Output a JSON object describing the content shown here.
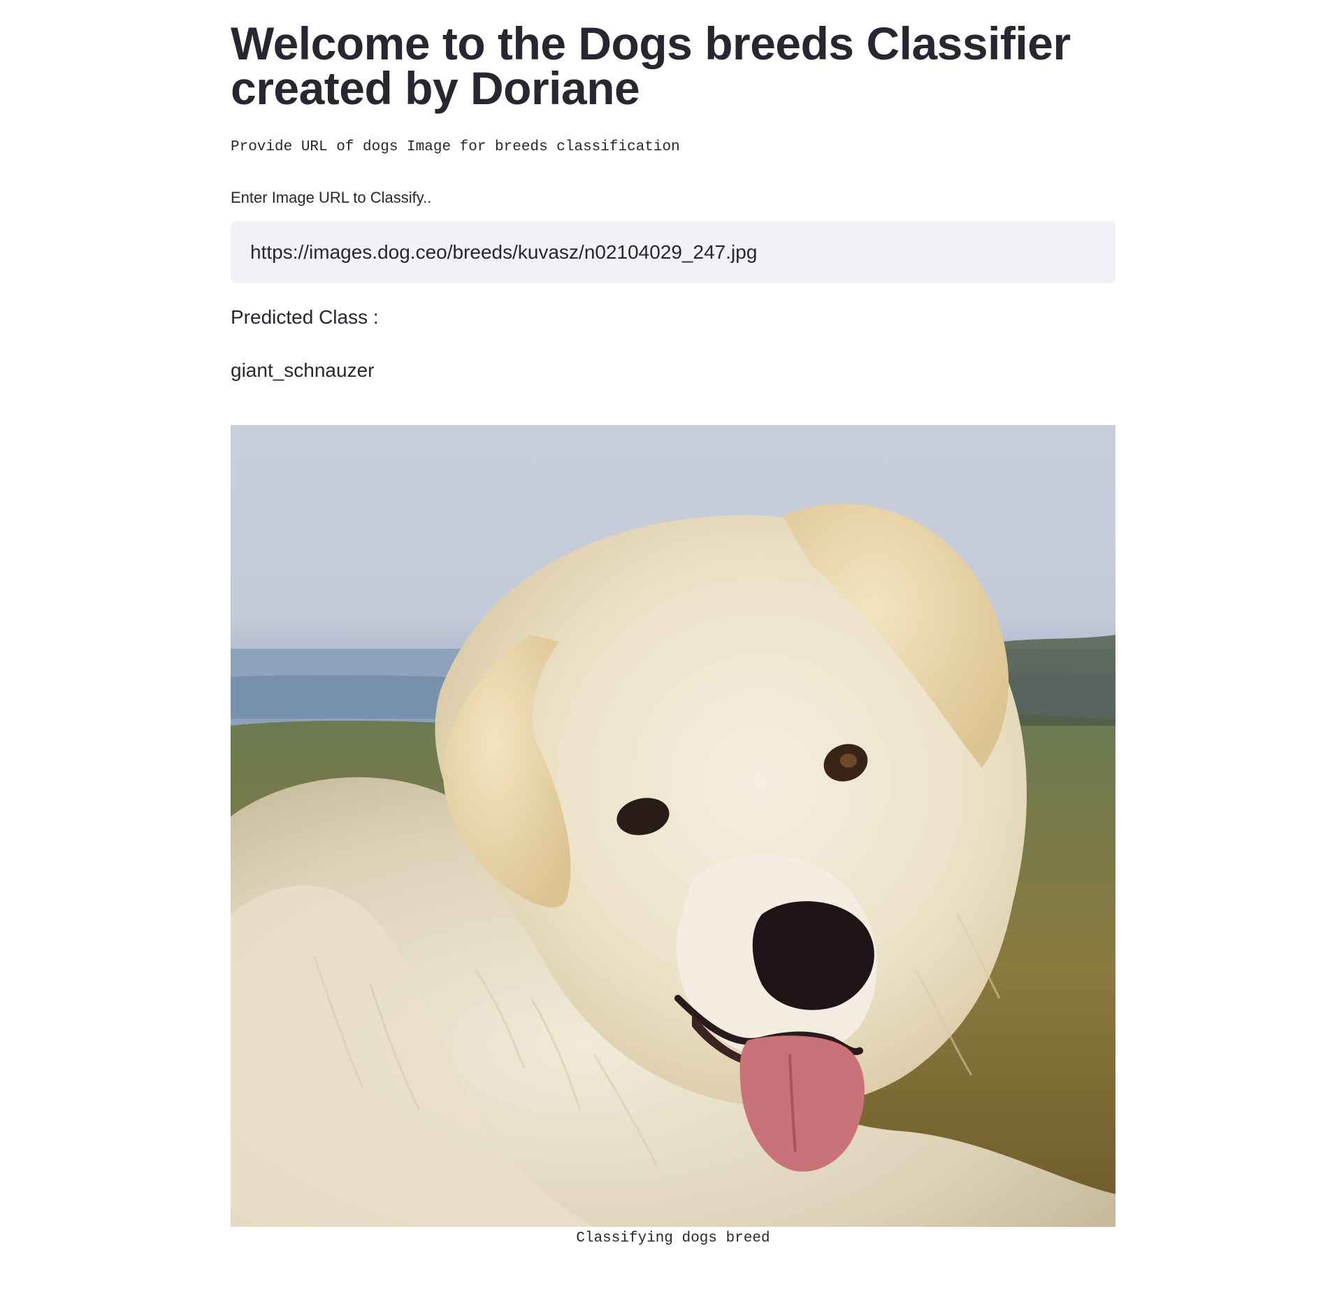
{
  "header": {
    "title": "Welcome to the Dogs breeds Classifier created by Doriane",
    "subtitle": "Provide URL of dogs Image for breeds classification"
  },
  "form": {
    "url_label": "Enter Image URL to Classify..",
    "url_value": "https://images.dog.ceo/breeds/kuvasz/n02104029_247.jpg"
  },
  "result": {
    "label": "Predicted Class :",
    "value": "giant_schnauzer"
  },
  "image": {
    "caption": "Classifying dogs breed",
    "alt": "Classifying dogs breed"
  }
}
